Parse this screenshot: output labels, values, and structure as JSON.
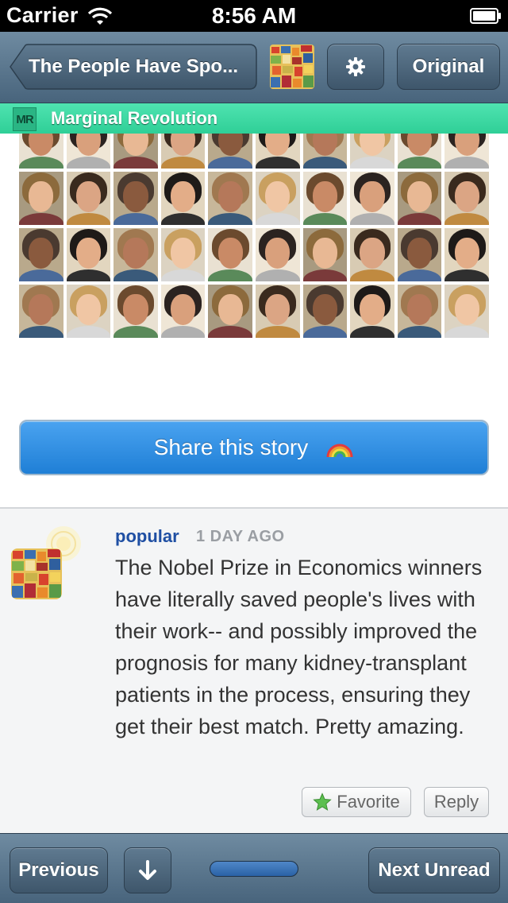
{
  "status_bar": {
    "carrier": "Carrier",
    "time": "8:56 AM"
  },
  "nav_bar": {
    "back_label": "The People Have Spo...",
    "original_label": "Original",
    "settings_icon": "gear-icon"
  },
  "feed_banner": {
    "logo_text": "MR",
    "name": "Marginal Revolution",
    "color": "#3ad9a2"
  },
  "share": {
    "label": "Share this story",
    "icon": "rainbow-icon"
  },
  "comment": {
    "username": "popular",
    "timestamp": "1 DAY AGO",
    "text": "The Nobel Prize in Economics winners have literally saved people's lives with their work-- and possibly improved the prognosis for many kidney-transplant patients in the process, ensuring they get their best match. Pretty amazing.",
    "favorite_label": "Favorite",
    "reply_label": "Reply"
  },
  "toolbar": {
    "previous_label": "Previous",
    "next_label": "Next Unread",
    "down_icon": "arrow-down-icon",
    "progress": 1.0
  },
  "colors": {
    "nav_top": "#6f8ba1",
    "nav_bottom": "#48647c",
    "share_button": "#2b8ae0",
    "username": "#1f4fa3"
  }
}
